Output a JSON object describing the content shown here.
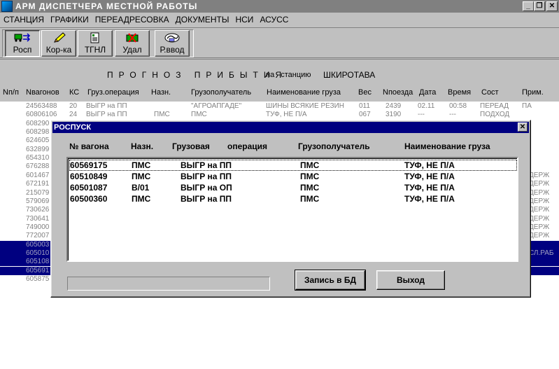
{
  "window": {
    "title": "АРМ ДИСПЕТЧЕРА МЕСТНОЙ РАБОТЫ",
    "btn_minimize": "_",
    "btn_restore": "❐",
    "btn_close": "✕"
  },
  "menu": [
    "СТАНЦИЯ",
    "ГРАФИКИ",
    "ПЕРЕАДРЕСОВКА",
    "ДОКУМЕНТЫ",
    "НСИ",
    "АСУСС"
  ],
  "toolbar": {
    "buttons": [
      {
        "label": "Росп",
        "icon": "dispatch-icon",
        "pressed": true
      },
      {
        "label": "Кор-ка",
        "icon": "pencil-icon",
        "pressed": false
      },
      {
        "label": "ТГНЛ",
        "icon": "document-icon",
        "pressed": false
      },
      {
        "label": "Удал",
        "icon": "delete-icon",
        "pressed": false
      },
      {
        "label": "Р.ввод",
        "icon": "manual-entry-icon",
        "pressed": false
      }
    ]
  },
  "forecast": {
    "title": "ПРОГНОЗ ПРИБЫТИЯ",
    "to_label": "на станцию",
    "station": "ШКИРОТАВА",
    "columns": [
      "Nп/п",
      "Nвагонов",
      "КС",
      "Груз.операция",
      "Назн.",
      "Грузополучатель",
      "Наименование груза",
      "Вес",
      "Nпоезда",
      "Дата",
      "Время",
      "Сост",
      "Прим."
    ],
    "rows": [
      {
        "num": "24563488",
        "ks": "20",
        "op": "ВЫГР на ПП",
        "dest": "",
        "recv": "\"АГРОАПГАДЕ\"",
        "cargo": "ШИНЫ ВСЯКИЕ РЕЗИН",
        "weight": "011",
        "train": "2439",
        "date": "02.11",
        "time": "00:58",
        "state": "ПЕРЕАД",
        "note": "ПА"
      },
      {
        "num": "60806106",
        "ks": "24",
        "op": "ВЫГР на ПП",
        "dest": "ПМС",
        "recv": "ПМС",
        "cargo": "ТУФ, НЕ П/А",
        "weight": "067",
        "train": "3190",
        "date": "---",
        "time": "---",
        "state": "ПОДХОД",
        "note": ""
      },
      {
        "num": "608290",
        "note": ""
      },
      {
        "num": "608298",
        "note": ""
      },
      {
        "num": "624605",
        "note": ""
      },
      {
        "num": "632899",
        "note": ""
      },
      {
        "num": "654310",
        "note": ""
      },
      {
        "num": "676288",
        "note": ""
      },
      {
        "num": "601467",
        "note": "ДЕРЖ"
      },
      {
        "num": "672191",
        "note": "ДЕРЖ"
      },
      {
        "num": "215079",
        "note": "ДЕРЖ"
      },
      {
        "num": "579069",
        "note": "ДЕРЖ"
      },
      {
        "num": "730626",
        "note": "ДЕРЖ"
      },
      {
        "num": "730641",
        "note": "ДЕРЖ"
      },
      {
        "num": "749000",
        "note": "ДЕРЖ"
      },
      {
        "num": "772007",
        "note": "ДЕРЖ"
      },
      {
        "num": "605003",
        "note": "",
        "selected": true
      },
      {
        "num": "605010",
        "note": "СЛ.РАБ",
        "selected": true
      },
      {
        "num": "605108",
        "note": "",
        "selected": true
      },
      {
        "num": "605691",
        "note": "",
        "selected": true
      },
      {
        "num": "605875",
        "note": ""
      }
    ]
  },
  "dialog": {
    "title": "РОСПУСК",
    "close": "✕",
    "headers": {
      "wagon": "№ вагона",
      "dest": "Назн.",
      "op1": "Грузовая",
      "op2": "операция",
      "recv": "Грузополучатель",
      "cargo": "Наименование груза"
    },
    "rows": [
      {
        "wagon": "60569175",
        "dest": "ПМС",
        "op": "ВЫГР на ПП",
        "recv": "ПМС",
        "cargo": "ТУФ, НЕ П/А"
      },
      {
        "wagon": "60510849",
        "dest": "ПМС",
        "op": "ВЫГР на ПП",
        "recv": "ПМС",
        "cargo": "ТУФ, НЕ П/А"
      },
      {
        "wagon": "60501087",
        "dest": "В/01",
        "op": "ВЫГР на ОП",
        "recv": "ПМС",
        "cargo": "ТУФ, НЕ П/А"
      },
      {
        "wagon": "60500360",
        "dest": "ПМС",
        "op": "ВЫГР на ПП",
        "recv": "ПМС",
        "cargo": "ТУФ, НЕ П/А"
      }
    ],
    "save_button": "Запись в БД",
    "exit_button": "Выход"
  },
  "colors": {
    "selection": "#000080",
    "title_inactive": "#808080",
    "dialog_title": "#000080"
  }
}
